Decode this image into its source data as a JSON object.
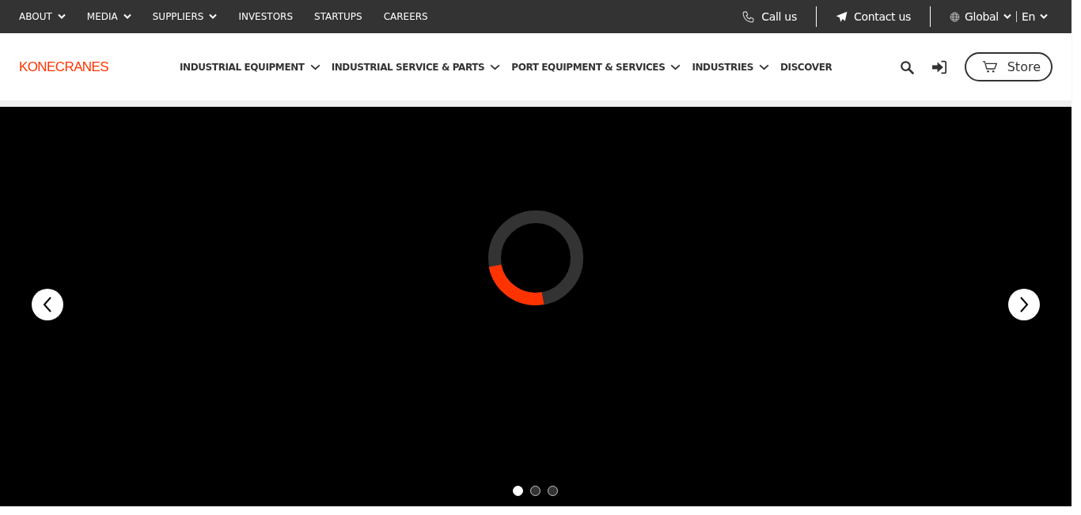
{
  "top_bar": {
    "links": [
      {
        "label": "ABOUT",
        "has_menu": true
      },
      {
        "label": "MEDIA",
        "has_menu": true
      },
      {
        "label": "SUPPLIERS",
        "has_menu": true
      },
      {
        "label": "INVESTORS",
        "has_menu": false
      },
      {
        "label": "STARTUPS",
        "has_menu": false
      },
      {
        "label": "CAREERS",
        "has_menu": false
      }
    ],
    "call": "Call us",
    "contact": "Contact us",
    "region": "Global",
    "language": "En"
  },
  "header": {
    "logo": "KONECRANES",
    "nav": [
      {
        "label": "INDUSTRIAL EQUIPMENT",
        "has_menu": true
      },
      {
        "label": "INDUSTRIAL SERVICE & PARTS",
        "has_menu": true
      },
      {
        "label": "PORT EQUIPMENT & SERVICES",
        "has_menu": true
      },
      {
        "label": "INDUSTRIES",
        "has_menu": true
      },
      {
        "label": "DISCOVER",
        "has_menu": false
      }
    ],
    "store": "Store"
  },
  "carousel": {
    "slides": [
      {
        "selected": true
      },
      {
        "selected": false
      },
      {
        "selected": false
      }
    ]
  }
}
